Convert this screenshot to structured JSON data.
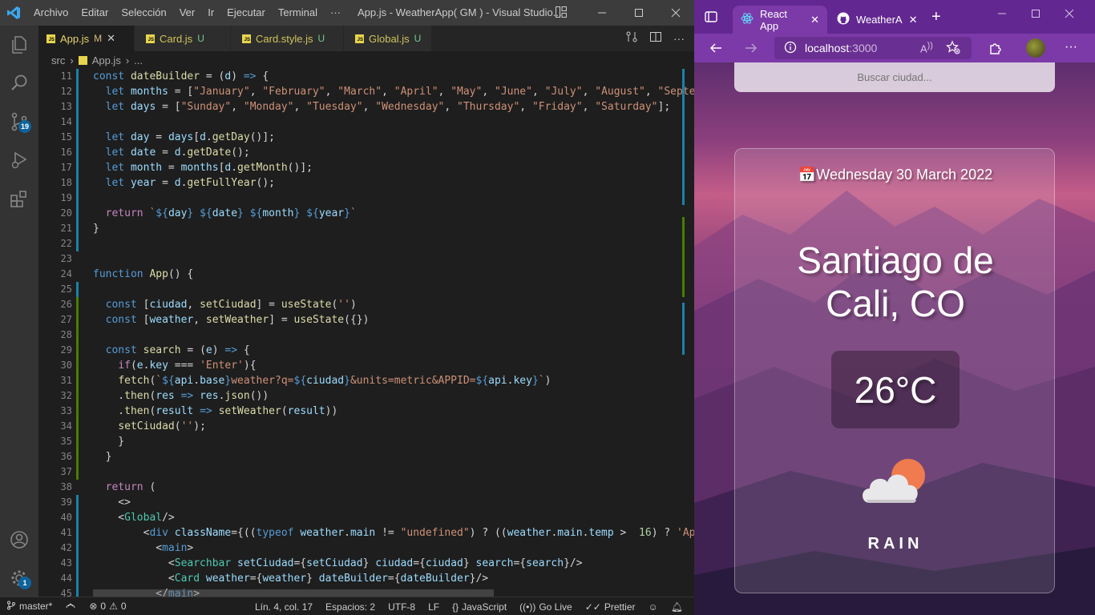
{
  "vscode": {
    "title": "App.js - WeatherApp( GM ) - Visual Studio...",
    "menu": [
      "Archivo",
      "Editar",
      "Selección",
      "Ver",
      "Ir",
      "Ejecutar",
      "Terminal",
      "···"
    ],
    "source_control_badge": "19",
    "settings_badge": "1",
    "tabs": [
      {
        "name": "App.js",
        "flag": "M"
      },
      {
        "name": "Card.js",
        "flag": "U"
      },
      {
        "name": "Card.style.js",
        "flag": "U"
      },
      {
        "name": "Global.js",
        "flag": "U"
      }
    ],
    "breadcrumb": [
      "src",
      "App.js",
      "..."
    ],
    "status": {
      "branch": "master*",
      "problems": "0",
      "warnings": "0",
      "position": "Lín. 4, col. 17",
      "spaces": "Espacios: 2",
      "encoding": "UTF-8",
      "eol": "LF",
      "language": "JavaScript",
      "golive": "Go Live",
      "prettier": "Prettier"
    },
    "code_lines": [
      {
        "n": "11",
        "seg": [
          [
            "kw",
            "const "
          ],
          [
            "fn",
            "dateBuilder"
          ],
          [
            "pun",
            " = ("
          ],
          [
            "var",
            "d"
          ],
          [
            "pun",
            ") "
          ],
          [
            "kw",
            "=>"
          ],
          [
            "pun",
            " {"
          ]
        ]
      },
      {
        "n": "12",
        "seg": [
          [
            "pun",
            "  "
          ],
          [
            "kw",
            "let "
          ],
          [
            "var",
            "months"
          ],
          [
            "pun",
            " = ["
          ],
          [
            "str",
            "\"January\""
          ],
          [
            "pun",
            ", "
          ],
          [
            "str",
            "\"February\""
          ],
          [
            "pun",
            ", "
          ],
          [
            "str",
            "\"March\""
          ],
          [
            "pun",
            ", "
          ],
          [
            "str",
            "\"April\""
          ],
          [
            "pun",
            ", "
          ],
          [
            "str",
            "\"May\""
          ],
          [
            "pun",
            ", "
          ],
          [
            "str",
            "\"June\""
          ],
          [
            "pun",
            ", "
          ],
          [
            "str",
            "\"July\""
          ],
          [
            "pun",
            ", "
          ],
          [
            "str",
            "\"August\""
          ],
          [
            "pun",
            ", "
          ],
          [
            "str",
            "\"Septem"
          ]
        ]
      },
      {
        "n": "13",
        "seg": [
          [
            "pun",
            "  "
          ],
          [
            "kw",
            "let "
          ],
          [
            "var",
            "days"
          ],
          [
            "pun",
            " = ["
          ],
          [
            "str",
            "\"Sunday\""
          ],
          [
            "pun",
            ", "
          ],
          [
            "str",
            "\"Monday\""
          ],
          [
            "pun",
            ", "
          ],
          [
            "str",
            "\"Tuesday\""
          ],
          [
            "pun",
            ", "
          ],
          [
            "str",
            "\"Wednesday\""
          ],
          [
            "pun",
            ", "
          ],
          [
            "str",
            "\"Thursday\""
          ],
          [
            "pun",
            ", "
          ],
          [
            "str",
            "\"Friday\""
          ],
          [
            "pun",
            ", "
          ],
          [
            "str",
            "\"Saturday\""
          ],
          [
            "pun",
            "];"
          ]
        ]
      },
      {
        "n": "14",
        "seg": []
      },
      {
        "n": "15",
        "seg": [
          [
            "pun",
            "  "
          ],
          [
            "kw",
            "let "
          ],
          [
            "var",
            "day"
          ],
          [
            "pun",
            " = "
          ],
          [
            "var",
            "days"
          ],
          [
            "pun",
            "["
          ],
          [
            "var",
            "d"
          ],
          [
            "pun",
            "."
          ],
          [
            "fn",
            "getDay"
          ],
          [
            "pun",
            "()];"
          ]
        ]
      },
      {
        "n": "16",
        "seg": [
          [
            "pun",
            "  "
          ],
          [
            "kw",
            "let "
          ],
          [
            "var",
            "date"
          ],
          [
            "pun",
            " = "
          ],
          [
            "var",
            "d"
          ],
          [
            "pun",
            "."
          ],
          [
            "fn",
            "getDate"
          ],
          [
            "pun",
            "();"
          ]
        ]
      },
      {
        "n": "17",
        "seg": [
          [
            "pun",
            "  "
          ],
          [
            "kw",
            "let "
          ],
          [
            "var",
            "month"
          ],
          [
            "pun",
            " = "
          ],
          [
            "var",
            "months"
          ],
          [
            "pun",
            "["
          ],
          [
            "var",
            "d"
          ],
          [
            "pun",
            "."
          ],
          [
            "fn",
            "getMonth"
          ],
          [
            "pun",
            "()];"
          ]
        ]
      },
      {
        "n": "18",
        "seg": [
          [
            "pun",
            "  "
          ],
          [
            "kw",
            "let "
          ],
          [
            "var",
            "year"
          ],
          [
            "pun",
            " = "
          ],
          [
            "var",
            "d"
          ],
          [
            "pun",
            "."
          ],
          [
            "fn",
            "getFullYear"
          ],
          [
            "pun",
            "();"
          ]
        ]
      },
      {
        "n": "19",
        "seg": []
      },
      {
        "n": "20",
        "seg": [
          [
            "pun",
            "  "
          ],
          [
            "ctl",
            "return "
          ],
          [
            "str",
            "`"
          ],
          [
            "tpl",
            "${"
          ],
          [
            "var",
            "day"
          ],
          [
            "tpl",
            "}"
          ],
          [
            "str",
            " "
          ],
          [
            "tpl",
            "${"
          ],
          [
            "var",
            "date"
          ],
          [
            "tpl",
            "}"
          ],
          [
            "str",
            " "
          ],
          [
            "tpl",
            "${"
          ],
          [
            "var",
            "month"
          ],
          [
            "tpl",
            "}"
          ],
          [
            "str",
            " "
          ],
          [
            "tpl",
            "${"
          ],
          [
            "var",
            "year"
          ],
          [
            "tpl",
            "}"
          ],
          [
            "str",
            "`"
          ]
        ]
      },
      {
        "n": "21",
        "seg": [
          [
            "pun",
            "}"
          ]
        ]
      },
      {
        "n": "22",
        "seg": []
      },
      {
        "n": "23",
        "seg": []
      },
      {
        "n": "24",
        "seg": [
          [
            "kw",
            "function "
          ],
          [
            "fn",
            "App"
          ],
          [
            "pun",
            "() {"
          ]
        ]
      },
      {
        "n": "25",
        "seg": []
      },
      {
        "n": "26",
        "seg": [
          [
            "pun",
            "  "
          ],
          [
            "kw",
            "const "
          ],
          [
            "pun",
            "["
          ],
          [
            "var",
            "ciudad"
          ],
          [
            "pun",
            ", "
          ],
          [
            "fn",
            "setCiudad"
          ],
          [
            "pun",
            "] = "
          ],
          [
            "fn",
            "useState"
          ],
          [
            "pun",
            "("
          ],
          [
            "str",
            "''"
          ],
          [
            "pun",
            ")"
          ]
        ]
      },
      {
        "n": "27",
        "seg": [
          [
            "pun",
            "  "
          ],
          [
            "kw",
            "const "
          ],
          [
            "pun",
            "["
          ],
          [
            "var",
            "weather"
          ],
          [
            "pun",
            ", "
          ],
          [
            "fn",
            "setWeather"
          ],
          [
            "pun",
            "] = "
          ],
          [
            "fn",
            "useState"
          ],
          [
            "pun",
            "({})"
          ]
        ]
      },
      {
        "n": "28",
        "seg": []
      },
      {
        "n": "29",
        "seg": [
          [
            "pun",
            "  "
          ],
          [
            "kw",
            "const "
          ],
          [
            "fn",
            "search"
          ],
          [
            "pun",
            " = ("
          ],
          [
            "var",
            "e"
          ],
          [
            "pun",
            ") "
          ],
          [
            "kw",
            "=>"
          ],
          [
            "pun",
            " {"
          ]
        ]
      },
      {
        "n": "30",
        "seg": [
          [
            "pun",
            "    "
          ],
          [
            "ctl",
            "if"
          ],
          [
            "pun",
            "("
          ],
          [
            "var",
            "e"
          ],
          [
            "pun",
            "."
          ],
          [
            "var",
            "key"
          ],
          [
            "pun",
            " === "
          ],
          [
            "str",
            "'Enter'"
          ],
          [
            "pun",
            "){"
          ]
        ]
      },
      {
        "n": "31",
        "seg": [
          [
            "pun",
            "    "
          ],
          [
            "fn",
            "fetch"
          ],
          [
            "pun",
            "("
          ],
          [
            "str",
            "`"
          ],
          [
            "tpl",
            "${"
          ],
          [
            "var",
            "api"
          ],
          [
            "pun",
            "."
          ],
          [
            "var",
            "base"
          ],
          [
            "tpl",
            "}"
          ],
          [
            "str",
            "weather?q="
          ],
          [
            "tpl",
            "${"
          ],
          [
            "var",
            "ciudad"
          ],
          [
            "tpl",
            "}"
          ],
          [
            "str",
            "&units=metric&APPID="
          ],
          [
            "tpl",
            "${"
          ],
          [
            "var",
            "api"
          ],
          [
            "pun",
            "."
          ],
          [
            "var",
            "key"
          ],
          [
            "tpl",
            "}"
          ],
          [
            "str",
            "`"
          ],
          [
            "pun",
            ")"
          ]
        ]
      },
      {
        "n": "32",
        "seg": [
          [
            "pun",
            "    ."
          ],
          [
            "fn",
            "then"
          ],
          [
            "pun",
            "("
          ],
          [
            "var",
            "res"
          ],
          [
            "pun",
            " "
          ],
          [
            "kw",
            "=>"
          ],
          [
            "pun",
            " "
          ],
          [
            "var",
            "res"
          ],
          [
            "pun",
            "."
          ],
          [
            "fn",
            "json"
          ],
          [
            "pun",
            "())"
          ]
        ]
      },
      {
        "n": "33",
        "seg": [
          [
            "pun",
            "    ."
          ],
          [
            "fn",
            "then"
          ],
          [
            "pun",
            "("
          ],
          [
            "var",
            "result"
          ],
          [
            "pun",
            " "
          ],
          [
            "kw",
            "=>"
          ],
          [
            "pun",
            " "
          ],
          [
            "fn",
            "setWeather"
          ],
          [
            "pun",
            "("
          ],
          [
            "var",
            "result"
          ],
          [
            "pun",
            "))"
          ]
        ]
      },
      {
        "n": "34",
        "seg": [
          [
            "pun",
            "    "
          ],
          [
            "fn",
            "setCiudad"
          ],
          [
            "pun",
            "("
          ],
          [
            "str",
            "''"
          ],
          [
            "pun",
            ");"
          ]
        ]
      },
      {
        "n": "35",
        "seg": [
          [
            "pun",
            "    }"
          ]
        ]
      },
      {
        "n": "36",
        "seg": [
          [
            "pun",
            "  }"
          ]
        ]
      },
      {
        "n": "37",
        "seg": []
      },
      {
        "n": "38",
        "seg": [
          [
            "pun",
            "  "
          ],
          [
            "ctl",
            "return"
          ],
          [
            "pun",
            " ("
          ]
        ]
      },
      {
        "n": "39",
        "seg": [
          [
            "pun",
            "    <>"
          ]
        ]
      },
      {
        "n": "40",
        "seg": [
          [
            "pun",
            "    <"
          ],
          [
            "tag",
            "Global"
          ],
          [
            "pun",
            "/>"
          ]
        ]
      },
      {
        "n": "41",
        "seg": [
          [
            "pun",
            "        <"
          ],
          [
            "kw",
            "div "
          ],
          [
            "var",
            "className"
          ],
          [
            "pun",
            "={(("
          ],
          [
            "kw",
            "typeof "
          ],
          [
            "var",
            "weather"
          ],
          [
            "pun",
            "."
          ],
          [
            "var",
            "main"
          ],
          [
            "pun",
            " != "
          ],
          [
            "str",
            "\"undefined\""
          ],
          [
            "pun",
            ") ? (("
          ],
          [
            "var",
            "weather"
          ],
          [
            "pun",
            "."
          ],
          [
            "var",
            "main"
          ],
          [
            "pun",
            "."
          ],
          [
            "var",
            "temp"
          ],
          [
            "pun",
            " >  "
          ],
          [
            "num",
            "16"
          ],
          [
            "pun",
            ") ? "
          ],
          [
            "str",
            "'App"
          ]
        ]
      },
      {
        "n": "42",
        "seg": [
          [
            "pun",
            "          <"
          ],
          [
            "kw",
            "main"
          ],
          [
            "pun",
            ">"
          ]
        ]
      },
      {
        "n": "43",
        "seg": [
          [
            "pun",
            "            <"
          ],
          [
            "tag",
            "Searchbar "
          ],
          [
            "var",
            "setCiudad"
          ],
          [
            "pun",
            "={"
          ],
          [
            "var",
            "setCiudad"
          ],
          [
            "pun",
            "} "
          ],
          [
            "var",
            "ciudad"
          ],
          [
            "pun",
            "={"
          ],
          [
            "var",
            "ciudad"
          ],
          [
            "pun",
            "} "
          ],
          [
            "var",
            "search"
          ],
          [
            "pun",
            "={"
          ],
          [
            "var",
            "search"
          ],
          [
            "pun",
            "}/>"
          ]
        ]
      },
      {
        "n": "44",
        "seg": [
          [
            "pun",
            "            <"
          ],
          [
            "tag",
            "Card "
          ],
          [
            "var",
            "weather"
          ],
          [
            "pun",
            "={"
          ],
          [
            "var",
            "weather"
          ],
          [
            "pun",
            "} "
          ],
          [
            "var",
            "dateBuilder"
          ],
          [
            "pun",
            "={"
          ],
          [
            "var",
            "dateBuilder"
          ],
          [
            "pun",
            "}/>"
          ]
        ]
      },
      {
        "n": "45",
        "seg": [
          [
            "pun",
            "          </"
          ],
          [
            "kw",
            "main"
          ],
          [
            "pun",
            ">"
          ]
        ]
      }
    ]
  },
  "edge": {
    "tabs": [
      {
        "title": "React App"
      },
      {
        "title": "WeatherA"
      }
    ],
    "address": {
      "host": "localhost",
      "port": ":3000"
    },
    "app": {
      "search_placeholder": "Buscar ciudad...",
      "date_icon": "📅",
      "date": "Wednesday 30 March 2022",
      "city_line1": "Santiago de",
      "city_line2": "Cali, CO",
      "temperature": "26°C",
      "condition": "RAIN",
      "weather_icon": "cloud-with-sun-icon"
    }
  },
  "colors": {
    "accent_blue": "#007acc",
    "edge_purple": "#7c3aa8",
    "edge_tab_purple": "#622791"
  }
}
